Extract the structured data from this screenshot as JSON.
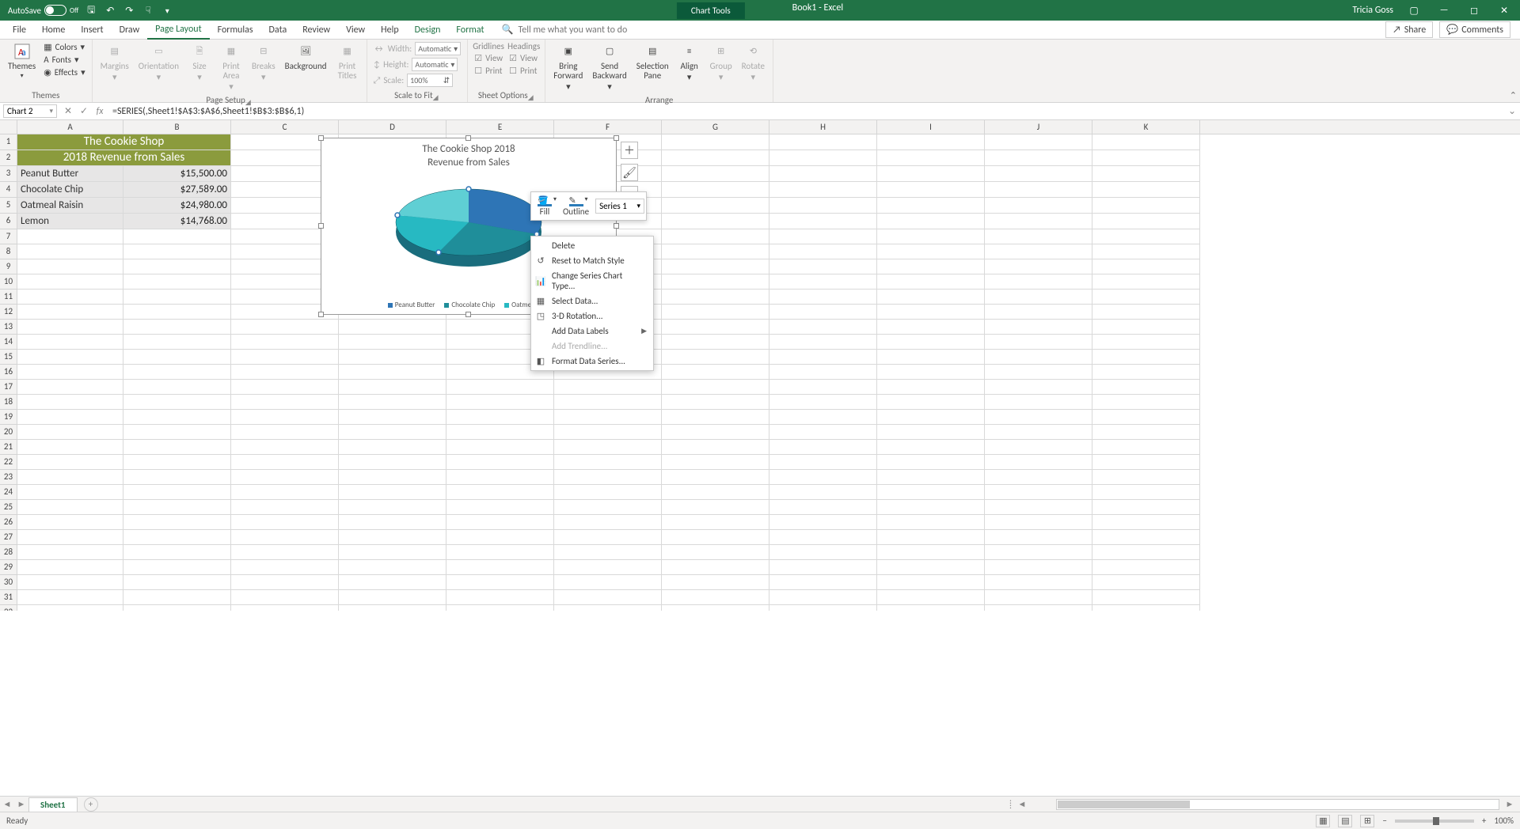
{
  "title_bar": {
    "autosave_label": "AutoSave",
    "autosave_state": "Off",
    "chart_tools": "Chart Tools",
    "book": "Book1  -  Excel",
    "user": "Tricia Goss"
  },
  "tabs": {
    "file": "File",
    "home": "Home",
    "insert": "Insert",
    "draw": "Draw",
    "page_layout": "Page Layout",
    "formulas": "Formulas",
    "data": "Data",
    "review": "Review",
    "view": "View",
    "help": "Help",
    "design": "Design",
    "format": "Format",
    "tell_me": "Tell me what you want to do",
    "share": "Share",
    "comments": "Comments"
  },
  "ribbon": {
    "themes": {
      "label": "Themes",
      "themes": "Themes",
      "colors": "Colors",
      "fonts": "Fonts",
      "effects": "Effects"
    },
    "page_setup": {
      "label": "Page Setup",
      "margins": "Margins",
      "orientation": "Orientation",
      "size": "Size",
      "print_area": "Print\nArea",
      "breaks": "Breaks",
      "background": "Background",
      "print_titles": "Print\nTitles"
    },
    "scale": {
      "label": "Scale to Fit",
      "width": "Width:",
      "height": "Height:",
      "scale": "Scale:",
      "auto": "Automatic",
      "pct": "100%"
    },
    "sheet_options": {
      "label": "Sheet Options",
      "gridlines": "Gridlines",
      "headings": "Headings",
      "view": "View",
      "print": "Print"
    },
    "arrange": {
      "label": "Arrange",
      "bring": "Bring\nForward",
      "send": "Send\nBackward",
      "selection": "Selection\nPane",
      "align": "Align",
      "group": "Group",
      "rotate": "Rotate"
    }
  },
  "formula_bar": {
    "name_box": "Chart 2",
    "formula": "=SERIES(,Sheet1!$A$3:$A$6,Sheet1!$B$3:$B$6,1)"
  },
  "columns": [
    "A",
    "B",
    "C",
    "D",
    "E",
    "F",
    "G",
    "H",
    "I",
    "J",
    "K"
  ],
  "rows": {
    "header1": "The Cookie Shop",
    "header2": "2018 Revenue from Sales",
    "data": [
      {
        "label": "Peanut Butter",
        "value": "$15,500.00"
      },
      {
        "label": "Chocolate Chip",
        "value": "$27,589.00"
      },
      {
        "label": "Oatmeal Raisin",
        "value": "$24,980.00"
      },
      {
        "label": "Lemon",
        "value": "$14,768.00"
      }
    ]
  },
  "chart": {
    "title_l1": "The Cookie Shop 2018",
    "title_l2": "Revenue from Sales",
    "legend": [
      "Peanut Butter",
      "Chocolate Chip",
      "Oatmeal Rais"
    ]
  },
  "chart_data": {
    "type": "pie",
    "title": "The Cookie Shop 2018 Revenue from Sales",
    "categories": [
      "Peanut Butter",
      "Chocolate Chip",
      "Oatmeal Raisin",
      "Lemon"
    ],
    "values": [
      15500.0,
      27589.0,
      24980.0,
      14768.0
    ],
    "colors": [
      "#2E75B6",
      "#1F8E9A",
      "#27B9C2",
      "#5FCFD4"
    ],
    "unit": "USD"
  },
  "mini_toolbar": {
    "fill": "Fill",
    "outline": "Outline",
    "series": "Series 1"
  },
  "context_menu": {
    "delete": "Delete",
    "reset": "Reset to Match Style",
    "change": "Change Series Chart Type...",
    "select": "Select Data...",
    "rotation": "3-D Rotation...",
    "labels": "Add Data Labels",
    "trendline": "Add Trendline...",
    "format": "Format Data Series..."
  },
  "sheet": {
    "tab": "Sheet1"
  },
  "status": {
    "ready": "Ready",
    "zoom": "100%"
  }
}
